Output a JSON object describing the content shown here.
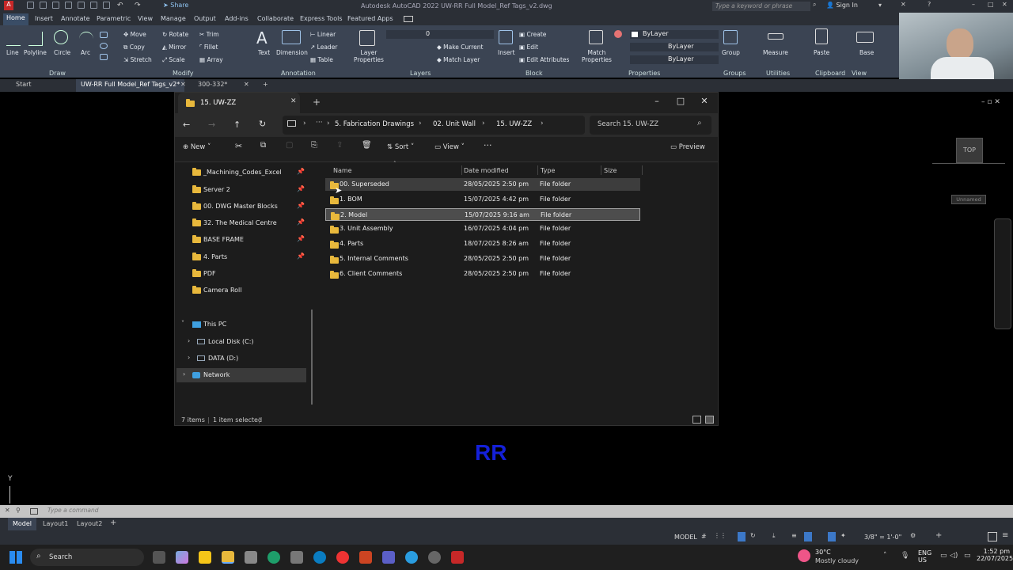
{
  "acad": {
    "quick_access_share": "Share",
    "title": "Autodesk AutoCAD 2022   UW-RR Full Model_Ref Tags_v2.dwg",
    "search_placeholder": "Type a keyword or phrase",
    "sign_in": "Sign In",
    "ribbon_tabs": [
      "Home",
      "Insert",
      "Annotate",
      "Parametric",
      "View",
      "Manage",
      "Output",
      "Add-ins",
      "Collaborate",
      "Express Tools",
      "Featured Apps"
    ],
    "draw_tools": [
      "Line",
      "Polyline",
      "Circle",
      "Arc"
    ],
    "modify_tools": [
      "Move",
      "Rotate",
      "Trim",
      "Copy",
      "Mirror",
      "Fillet",
      "Stretch",
      "Scale",
      "Array"
    ],
    "text": "Text",
    "dimension": "Dimension",
    "annotation_tools": [
      "Linear",
      "Leader",
      "Table"
    ],
    "layer_properties": "Layer Properties",
    "layer_value": "0",
    "layer_tools": [
      "Make Current",
      "Match Layer"
    ],
    "insert": "Insert",
    "block_tools": [
      "Create",
      "Edit",
      "Edit Attributes"
    ],
    "match_properties": "Match Properties",
    "bylayer": "ByLayer",
    "group": "Group",
    "measure": "Measure",
    "paste": "Paste",
    "base": "Base",
    "group_labels": [
      "Draw",
      "Modify",
      "Annotation",
      "Layers",
      "Block",
      "Properties",
      "Groups",
      "Utilities",
      "Clipboard",
      "View"
    ],
    "doc_tabs": [
      "Start",
      "UW-RR Full Model_Ref Tags_v2*",
      "300-332*"
    ],
    "viewcube": "TOP",
    "unnamed": "Unnamed",
    "canvas_text": "RR",
    "command_placeholder": "Type a command",
    "layout_tabs": [
      "Model",
      "Layout1",
      "Layout2"
    ],
    "model_label": "MODEL",
    "scale": "3/8\" = 1'-0\""
  },
  "explorer": {
    "tab_title": "15. UW-ZZ",
    "breadcrumbs": [
      "5. Fabrication Drawings",
      "02. Unit Wall",
      "15. UW-ZZ"
    ],
    "search_placeholder": "Search 15. UW-ZZ",
    "new": "New",
    "sort": "Sort",
    "view": "View",
    "preview": "Preview",
    "quick_access": [
      {
        "label": "_Machining_Codes_Excel",
        "pinned": true
      },
      {
        "label": "Server 2",
        "pinned": true
      },
      {
        "label": "00. DWG Master Blocks",
        "pinned": true
      },
      {
        "label": "32. The Medical Centre",
        "pinned": true
      },
      {
        "label": "BASE FRAME",
        "pinned": true
      },
      {
        "label": "4. Parts",
        "pinned": true
      },
      {
        "label": "PDF",
        "pinned": false
      },
      {
        "label": "Camera Roll",
        "pinned": false
      }
    ],
    "this_pc": "This PC",
    "drives": [
      "Local Disk (C:)",
      "DATA (D:)"
    ],
    "network": "Network",
    "columns": [
      "Name",
      "Date modified",
      "Type",
      "Size"
    ],
    "files": [
      {
        "name": "00. Superseded",
        "date": "28/05/2025 2:50 pm",
        "type": "File folder"
      },
      {
        "name": "1. BOM",
        "date": "15/07/2025 4:42 pm",
        "type": "File folder"
      },
      {
        "name": "2. Model",
        "date": "15/07/2025 9:16 am",
        "type": "File folder"
      },
      {
        "name": "3. Unit Assembly",
        "date": "16/07/2025 4:04 pm",
        "type": "File folder"
      },
      {
        "name": "4. Parts",
        "date": "18/07/2025 8:26 am",
        "type": "File folder"
      },
      {
        "name": "5. Internal Comments",
        "date": "28/05/2025 2:50 pm",
        "type": "File folder"
      },
      {
        "name": "6. Client Comments",
        "date": "28/05/2025 2:50 pm",
        "type": "File folder"
      }
    ],
    "status_items": "7 items",
    "status_selected": "1 item selected"
  },
  "taskbar": {
    "search": "Search",
    "weather_temp": "30°C",
    "weather_desc": "Mostly cloudy",
    "lang1": "ENG",
    "lang2": "US",
    "time": "1:52 pm",
    "date": "22/07/2025"
  }
}
